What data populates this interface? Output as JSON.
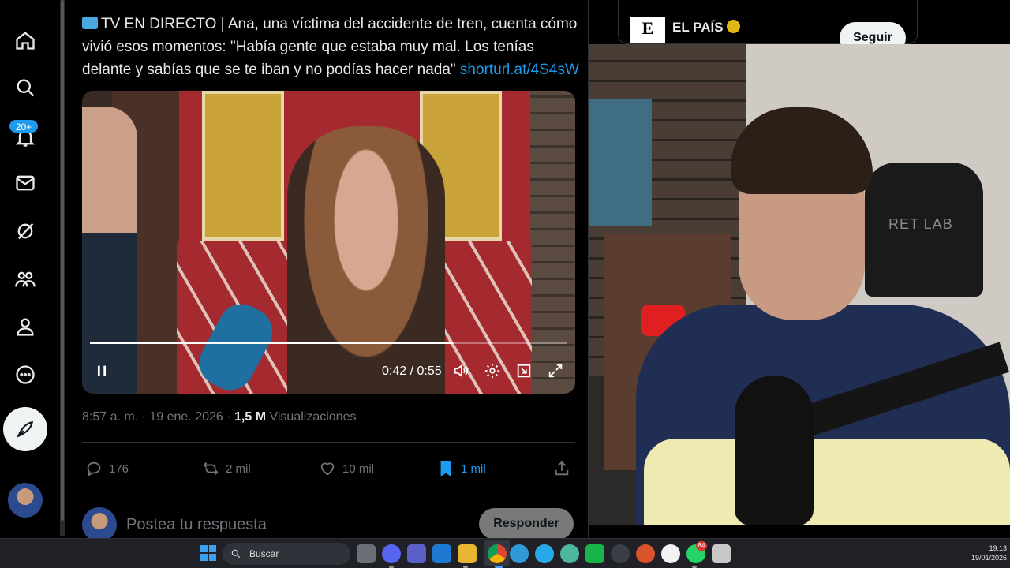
{
  "tweet": {
    "text": "TV EN DIRECTO | Ana, una víctima del accidente de tren, cuenta cómo vivió esos momentos: \"Había gente que estaba muy mal. Los tenías delante y sabías que se te iban y no podías hacer nada\"",
    "link": "shorturl.at/4S4sW",
    "video": {
      "time": "0:42 / 0:55",
      "progress": 0.76
    },
    "meta": {
      "datetime": "8:57 a. m. · 19 ene. 2026 · ",
      "views": "1,5 M",
      "views_label": " Visualizaciones"
    },
    "actions": {
      "replies": "176",
      "reposts": "2 mil",
      "likes": "10 mil",
      "bookmarks": "1 mil"
    },
    "reply_placeholder": "Postea tu respuesta",
    "reply_button": "Responder"
  },
  "sidebar": {
    "notifications_badge": "20+",
    "icons": [
      "home-icon",
      "search-icon",
      "notifications-icon",
      "messages-icon",
      "grok-icon",
      "communities-icon",
      "profile-icon",
      "more-icon",
      "post-icon"
    ]
  },
  "profile_card": {
    "logo": "E",
    "name": "EL PAÍS",
    "follow_label": "Seguir"
  },
  "webcam": {
    "chair_label": "RET LAB"
  },
  "taskbar": {
    "search_placeholder": "Buscar",
    "whatsapp_badge": "84",
    "time": "19:13",
    "date": "19/01/2026"
  },
  "colors": {
    "accent": "#1d9bf0",
    "background": "#000000",
    "muted_text": "#71767b"
  }
}
